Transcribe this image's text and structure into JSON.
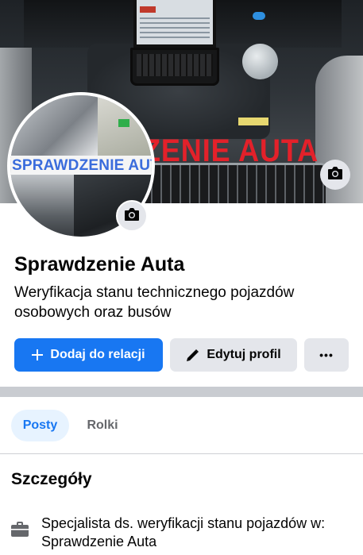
{
  "cover": {
    "overlay_text": "ZENIE AUTA",
    "camera_icon": "camera-icon"
  },
  "avatar": {
    "overlay_text": "SPRAWDZENIE AUTA",
    "camera_icon": "camera-icon"
  },
  "profile": {
    "name": "Sprawdzenie Auta",
    "bio": "Weryfikacja stanu technicznego pojazdów osobowych oraz busów"
  },
  "actions": {
    "add_story_label": "Dodaj do relacji",
    "add_story_icon": "plus-icon",
    "edit_profile_label": "Edytuj profil",
    "edit_profile_icon": "pencil-icon",
    "more_label": "•••",
    "more_icon": "more-horizontal-icon"
  },
  "tabs": [
    {
      "label": "Posty",
      "selected": true
    },
    {
      "label": "Rolki",
      "selected": false
    }
  ],
  "details": {
    "title": "Szczegóły",
    "items": [
      {
        "icon": "briefcase-icon",
        "text": "Specjalista ds. weryfikacji stanu pojazdów w: Sprawdzenie Auta"
      }
    ]
  },
  "colors": {
    "primary": "#1877f2",
    "secondary_bg": "#e4e6eb",
    "tab_selected_bg": "#e7f3ff",
    "cover_text": "#e3212a",
    "avatar_text": "#3a6cdc"
  }
}
